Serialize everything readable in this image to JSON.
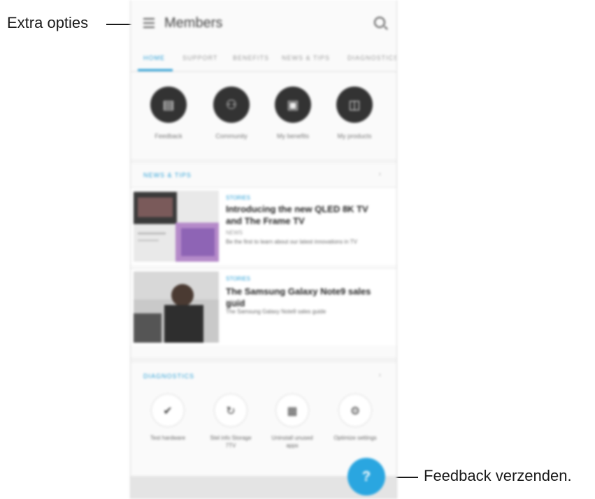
{
  "callouts": {
    "more_options": "Extra opties",
    "send_feedback": "Feedback verzenden."
  },
  "app": {
    "title": "Members"
  },
  "tabs": [
    "HOME",
    "SUPPORT",
    "BENEFITS",
    "NEWS & TIPS",
    "DIAGNOSTICS"
  ],
  "quick_actions": [
    {
      "label": "Feedback",
      "icon": "document-icon"
    },
    {
      "label": "Community",
      "icon": "community-icon"
    },
    {
      "label": "My benefits",
      "icon": "gift-icon"
    },
    {
      "label": "My products",
      "icon": "devices-icon"
    }
  ],
  "news": {
    "header": "NEWS & TIPS",
    "items": [
      {
        "tag": "STORIES",
        "title": "Introducing the new QLED 8K TV and The Frame TV",
        "sub": "NEWS",
        "desc": "Be the first to learn about our latest innovations in TV"
      },
      {
        "tag": "STORIES",
        "title": "The Samsung Galaxy Note9 sales guid",
        "sub": "NEWS",
        "desc": "The Samsung Galaxy Note9 sales guide"
      }
    ]
  },
  "diagnostics": {
    "header": "DIAGNOSTICS",
    "tools": [
      {
        "label": "Test hardware",
        "icon": "check-icon"
      },
      {
        "label": "Stel info Storage 7TV",
        "icon": "sync-icon"
      },
      {
        "label": "Uninstall unused apps",
        "icon": "apps-grid-icon"
      },
      {
        "label": "Optimize settings",
        "icon": "settings-icon"
      }
    ]
  },
  "fab": {
    "label": "?"
  },
  "colors": {
    "accent": "#2aa6e0",
    "dark_circle": "#333333"
  }
}
